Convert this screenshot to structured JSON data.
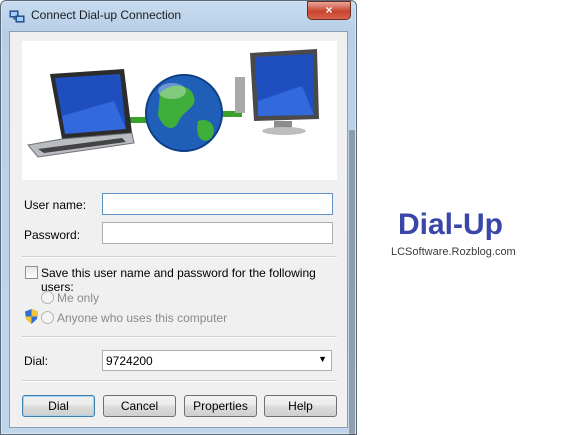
{
  "window": {
    "title": "Connect Dial-up Connection",
    "close_glyph": "×"
  },
  "form": {
    "username_label": "User name:",
    "username_value": "",
    "password_label": "Password:",
    "password_value": "",
    "save_label": "Save this user name and password for the following users:",
    "me_only_label": "Me only",
    "anyone_label": "Anyone who uses this computer",
    "dial_label": "Dial:",
    "dial_value": "9724200"
  },
  "buttons": {
    "dial": "Dial",
    "cancel": "Cancel",
    "properties": "Properties",
    "help": "Help"
  },
  "brand": {
    "title": "Dial-Up",
    "subtitle": "LCSoftware.Rozblog.com"
  },
  "icons": {
    "title": "network-connection-icon",
    "banner": "laptop-globe-monitor-illustration",
    "shield": "uac-shield-icon",
    "dropdown": "chevron-down-icon"
  }
}
